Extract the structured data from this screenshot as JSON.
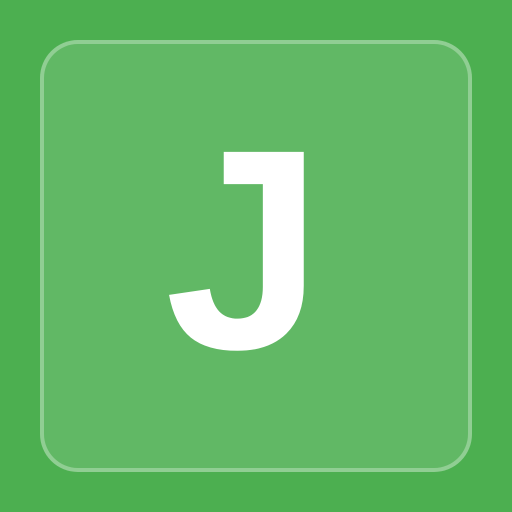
{
  "app_icon": {
    "letter": "J",
    "background_color": "#4caf50",
    "tile_fill": "rgba(255,255,255,0.12)",
    "tile_border": "rgba(255,255,255,0.3)",
    "letter_color": "#ffffff"
  }
}
